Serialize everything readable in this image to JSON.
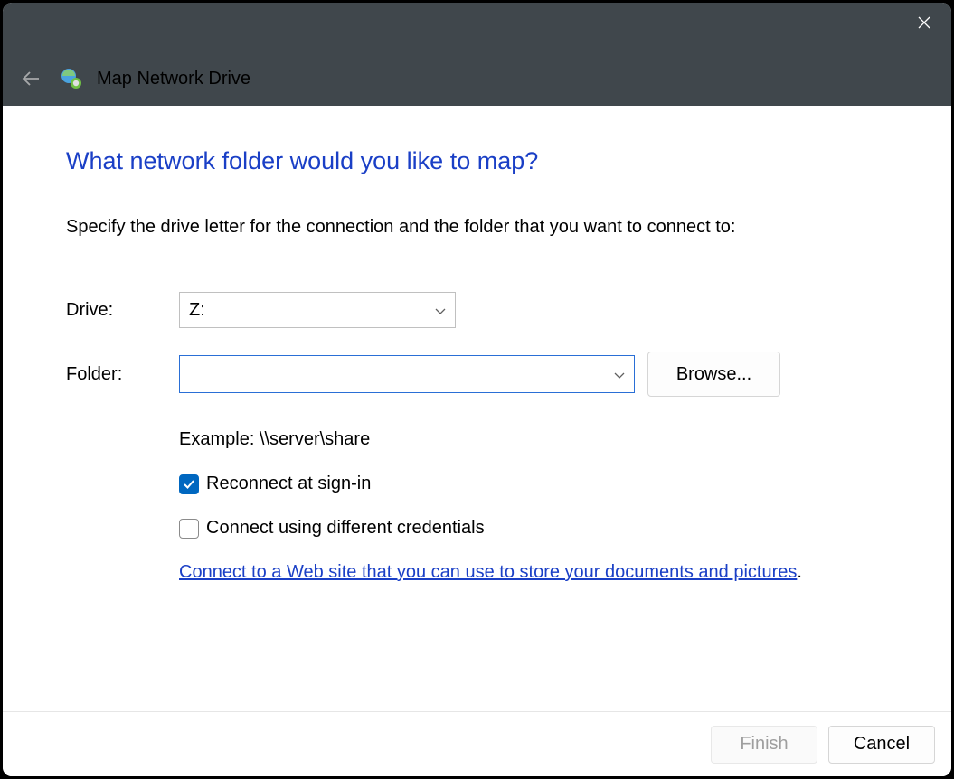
{
  "header": {
    "title": "Map Network Drive"
  },
  "content": {
    "question": "What network folder would you like to map?",
    "instruction": "Specify the drive letter for the connection and the folder that you want to connect to:",
    "drive_label": "Drive:",
    "drive_value": "Z:",
    "folder_label": "Folder:",
    "folder_value": "",
    "browse_label": "Browse...",
    "example": "Example: \\\\server\\share",
    "reconnect_label": "Reconnect at sign-in",
    "reconnect_checked": true,
    "diffcreds_label": "Connect using different credentials",
    "diffcreds_checked": false,
    "link_text": "Connect to a Web site that you can use to store your documents and pictures",
    "link_period": "."
  },
  "footer": {
    "finish_label": "Finish",
    "finish_enabled": false,
    "cancel_label": "Cancel"
  }
}
